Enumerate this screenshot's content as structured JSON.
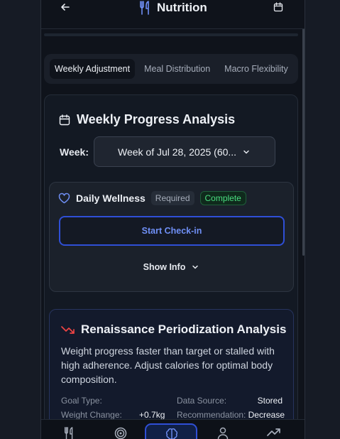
{
  "header": {
    "title": "Nutrition"
  },
  "tabs": [
    {
      "label": "Weekly Adjustment",
      "active": true
    },
    {
      "label": "Meal Distribution",
      "active": false
    },
    {
      "label": "Macro Flexibility",
      "active": false
    }
  ],
  "weekly_progress": {
    "title": "Weekly Progress Analysis",
    "week_label": "Week:",
    "week_value": "Week of Jul 28, 2025 (60..."
  },
  "daily_wellness": {
    "title": "Daily Wellness",
    "required_badge": "Required",
    "status_badge": "Complete",
    "checkin_label": "Start Check-in",
    "show_info_label": "Show Info"
  },
  "renaissance": {
    "title": "Renaissance Periodization Analysis",
    "description": "Weight progress faster than target or stalled with high adherence. Adjust calories for optimal body composition.",
    "goal_type_label": "Goal Type:",
    "goal_type_value": "",
    "data_source_label": "Data Source:",
    "data_source_value": "Stored",
    "weight_change_label": "Weight Change:",
    "weight_change_value": "+0.7kg",
    "recommendation_label": "Recommendation:",
    "recommendation_value": "Decrease"
  },
  "bottom_nav": {
    "items": [
      "utensils-icon",
      "target-icon",
      "brain-icon",
      "user-icon",
      "trending-up-icon"
    ],
    "active_index": 2
  },
  "colors": {
    "accent": "#2f4fd6",
    "accent_text": "#6f8ff5",
    "success": "#4ade80",
    "danger": "#ef4444",
    "background": "#0f131b"
  }
}
